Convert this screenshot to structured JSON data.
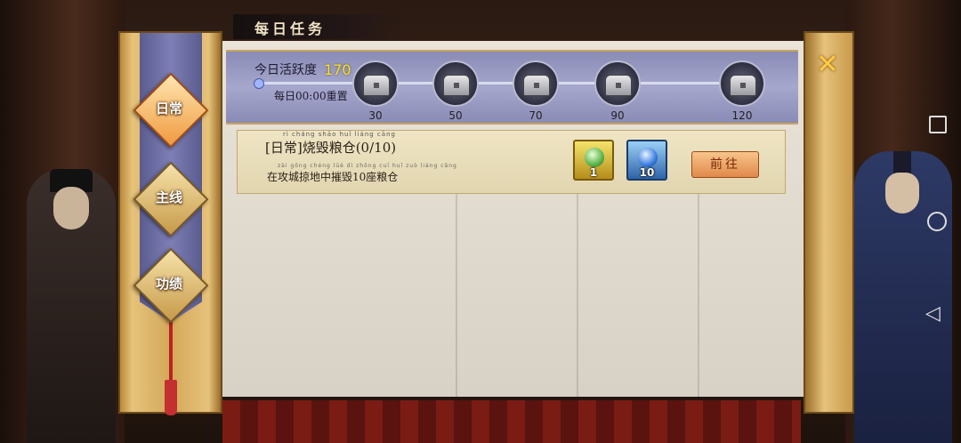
{
  "title": "每日任务",
  "tabs": [
    {
      "label": "日常",
      "active": true
    },
    {
      "label": "主线",
      "active": false
    },
    {
      "label": "功绩",
      "active": false
    }
  ],
  "activity": {
    "label": "今日活跃度",
    "value": "170",
    "reset_text": "每日00:00重置",
    "chests": [
      {
        "threshold": "30",
        "icon": "chest-icon"
      },
      {
        "threshold": "50",
        "icon": "chest-icon"
      },
      {
        "threshold": "70",
        "icon": "chest-icon"
      },
      {
        "threshold": "90",
        "icon": "chest-icon"
      },
      {
        "threshold": "120",
        "icon": "chest-icon"
      }
    ]
  },
  "task": {
    "title": "[日常]烧毁粮仓(0/10)",
    "title_pinyin": "rì  cháng  shāo  huǐ  liáng  cāng",
    "description": "在攻城掠地中摧毁10座粮仓",
    "description_pinyin": "zài gōng chéng lüè dì zhōng cuī huǐ    zuò liáng cāng",
    "rewards": [
      {
        "icon": "green-gem-icon",
        "count": "1"
      },
      {
        "icon": "blue-orb-icon",
        "count": "10"
      }
    ],
    "go_label": "前往"
  },
  "close_icon": "close-icon",
  "colors": {
    "activity_value": "#f7e03a",
    "close": "#ffcc44",
    "banner": "#7d7fb6"
  }
}
